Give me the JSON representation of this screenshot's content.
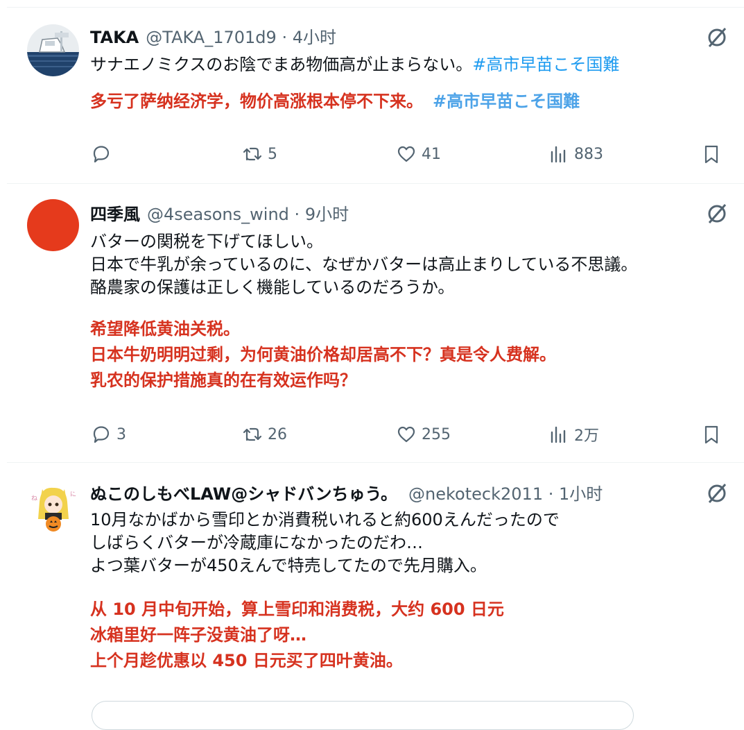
{
  "posts": [
    {
      "name": "TAKA",
      "handle": "@TAKA_1701d9",
      "dot": "·",
      "time": "4小时",
      "text_jp": [
        "サナエノミクスのお陰でまあ物価高が止まらない。"
      ],
      "hashtag_jp": "#高市早苗こそ国難",
      "text_cn": [
        "多亏了萨纳经济学，物价高涨根本停不下来。"
      ],
      "hashtag_cn": "#高市早苗こそ国難",
      "replies": "",
      "reposts": "5",
      "likes": "41",
      "views": "883"
    },
    {
      "name": "四季風",
      "handle": "@4seasons_wind",
      "dot": "·",
      "time": "9小时",
      "text_jp": [
        "バターの関税を下げてほしい。",
        "日本で牛乳が余っているのに、なぜかバターは高止まりしている不思議。",
        "酪農家の保護は正しく機能しているのだろうか。"
      ],
      "text_cn": [
        "希望降低黄油关税。",
        "日本牛奶明明过剩，为何黄油价格却居高不下？真是令人费解。",
        "乳农的保护措施真的在有效运作吗？"
      ],
      "replies": "3",
      "reposts": "26",
      "likes": "255",
      "views": "2万"
    },
    {
      "name": "ぬこのしもべLAW@シャドバンちゅう。",
      "handle": "@nekoteck2011",
      "dot": "·",
      "time": "1小时",
      "text_jp": [
        "10月なかばから雪印とか消費税いれると約600えんだったので",
        "しばらくバターが冷蔵庫になかったのだわ…",
        "よつ葉バターが450えんで特売してたので先月購入。"
      ],
      "text_cn": [
        "从 10 月中旬开始，算上雪印和消费税，大约 600 日元",
        "冰箱里好一阵子没黄油了呀…",
        "上个月趁优惠以 450 日元买了四叶黄油。"
      ]
    }
  ],
  "icons": {
    "reply": "reply-bubble-icon",
    "repost": "repost-arrows-icon",
    "like": "heart-icon",
    "views": "bar-chart-icon",
    "bookmark": "bookmark-icon",
    "grok": "slashed-circle-icon"
  },
  "colors": {
    "translation": "#d6321f",
    "hashtag": "#1d9bf0",
    "muted": "#536471"
  }
}
